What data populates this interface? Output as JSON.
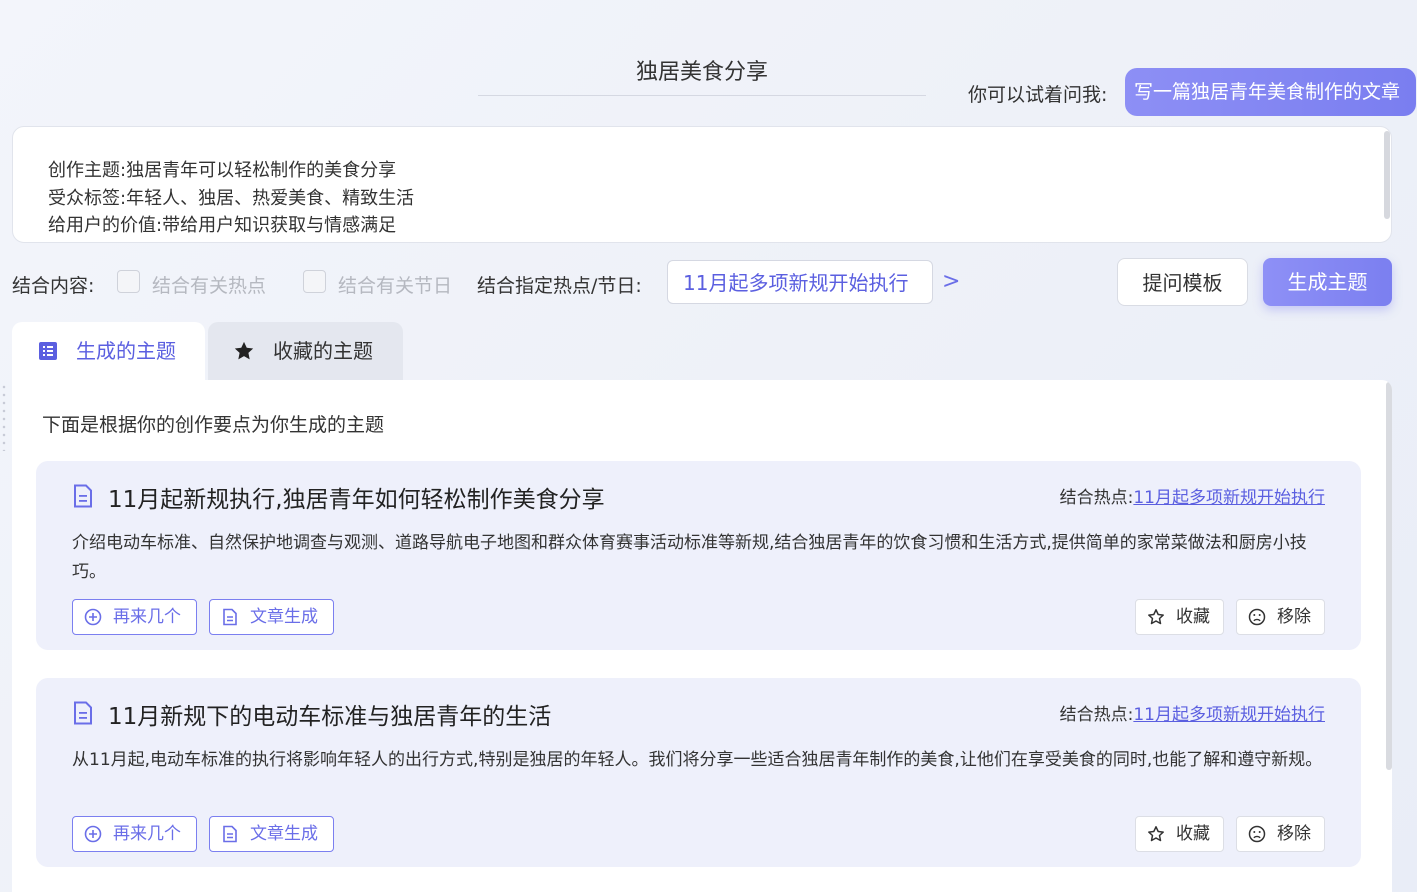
{
  "header": {
    "topic_title": "独居美食分享",
    "ask_label": "你可以试着问我:",
    "ask_suggestion": "写一篇独居青年美食制作的文章"
  },
  "prompt": {
    "line1": "创作主题:独居青年可以轻松制作的美食分享",
    "line2": "受众标签:年轻人、独居、热爱美食、精致生活",
    "line3": "给用户的价值:带给用户知识获取与情感满足"
  },
  "options": {
    "label": "结合内容:",
    "related_hot": "结合有关热点",
    "related_holiday": "结合有关节日",
    "specified_label": "结合指定热点/节日:",
    "specified_value": "11月起多项新规开始执行",
    "chevron": ">",
    "template_button": "提问模板",
    "generate_button": "生成主题"
  },
  "tabs": {
    "generated": "生成的主题",
    "favorites": "收藏的主题"
  },
  "panel": {
    "intro": "下面是根据你的创作要点为你生成的主题"
  },
  "cards": [
    {
      "title": "11月起新规执行,独居青年如何轻松制作美食分享",
      "hot_label": "结合热点:",
      "hot_link": "11月起多项新规开始执行",
      "desc": "介绍电动车标准、自然保护地调查与观测、道路导航电子地图和群众体育赛事活动标准等新规,结合独居青年的饮食习惯和生活方式,提供简单的家常菜做法和厨房小技巧。",
      "more_button": "再来几个",
      "article_button": "文章生成",
      "favorite_button": "收藏",
      "remove_button": "移除"
    },
    {
      "title": "11月新规下的电动车标准与独居青年的生活",
      "hot_label": "结合热点:",
      "hot_link": "11月起多项新规开始执行",
      "desc": "从11月起,电动车标准的执行将影响年轻人的出行方式,特别是独居的年轻人。我们将分享一些适合独居青年制作的美食,让他们在享受美食的同时,也能了解和遵守新规。",
      "more_button": "再来几个",
      "article_button": "文章生成",
      "favorite_button": "收藏",
      "remove_button": "移除"
    }
  ],
  "colors": {
    "accent": "#7b7ff0",
    "link": "#5b5fe0",
    "card_bg": "#eef0fb"
  }
}
